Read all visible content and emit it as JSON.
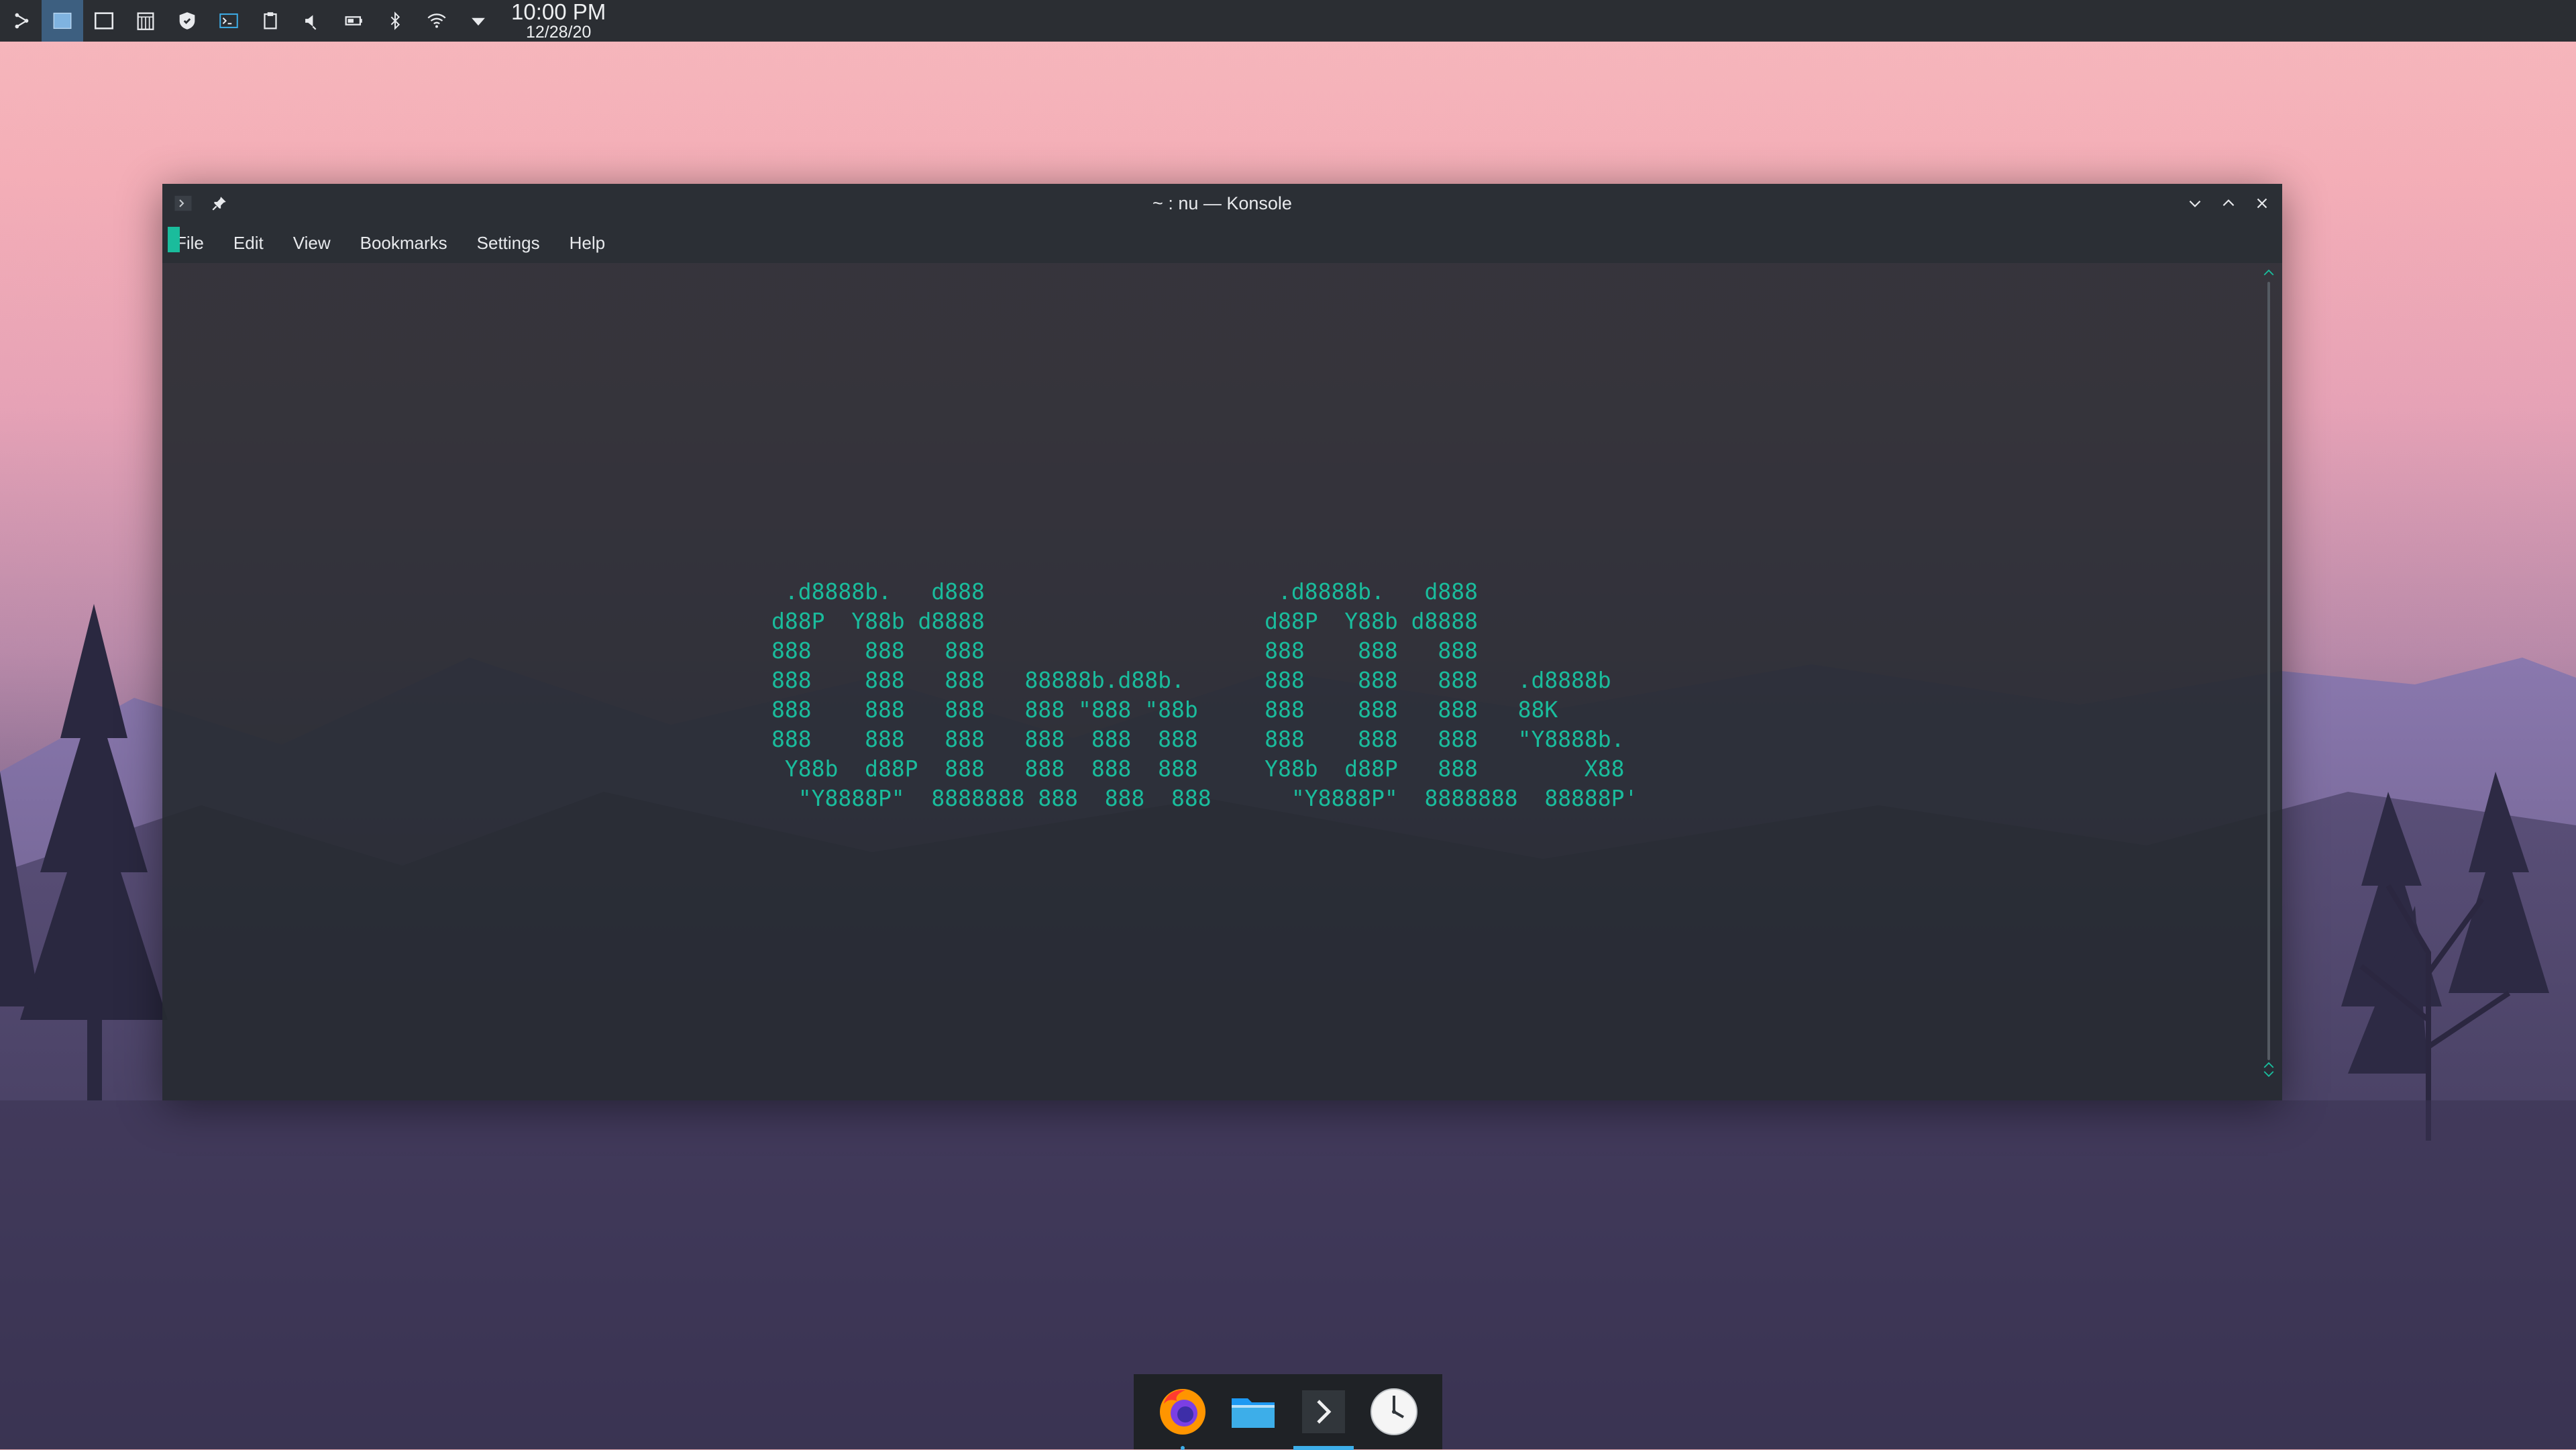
{
  "panel": {
    "clock_time": "10:00 PM",
    "clock_date": "12/28/20",
    "tray_icons": [
      "app-launcher-icon",
      "desktop-pager-icon",
      "show-desktop-icon",
      "clipboard-history-icon",
      "security-shield-icon",
      "terminal-tray-icon",
      "clipboard-icon",
      "volume-muted-icon",
      "battery-icon",
      "bluetooth-icon",
      "wifi-icon",
      "expand-tray-icon"
    ]
  },
  "window": {
    "title": "~ : nu — Konsole",
    "menu": [
      "File",
      "Edit",
      "View",
      "Bookmarks",
      "Settings",
      "Help"
    ]
  },
  "terminal": {
    "accent": "#1abc9c",
    "ascii_art": " .d8888b.   d888                      .d8888b.   d888\nd88P  Y88b d8888                     d88P  Y88b d8888\n888    888   888                     888    888   888\n888    888   888   88888b.d88b.      888    888   888   .d8888b\n888    888   888   888 \"888 \"88b     888    888   888   88K\n888    888   888   888  888  888     888    888   888   \"Y8888b.\n Y88b  d88P  888   888  888  888     Y88b  d88P   888        X88\n  \"Y8888P\"  8888888 888  888  888      \"Y8888P\"  8888888  88888P'"
  },
  "dock": {
    "apps": [
      "firefox-icon",
      "file-manager-icon",
      "konsole-icon",
      "clock-icon"
    ],
    "active_app": "konsole-icon"
  }
}
